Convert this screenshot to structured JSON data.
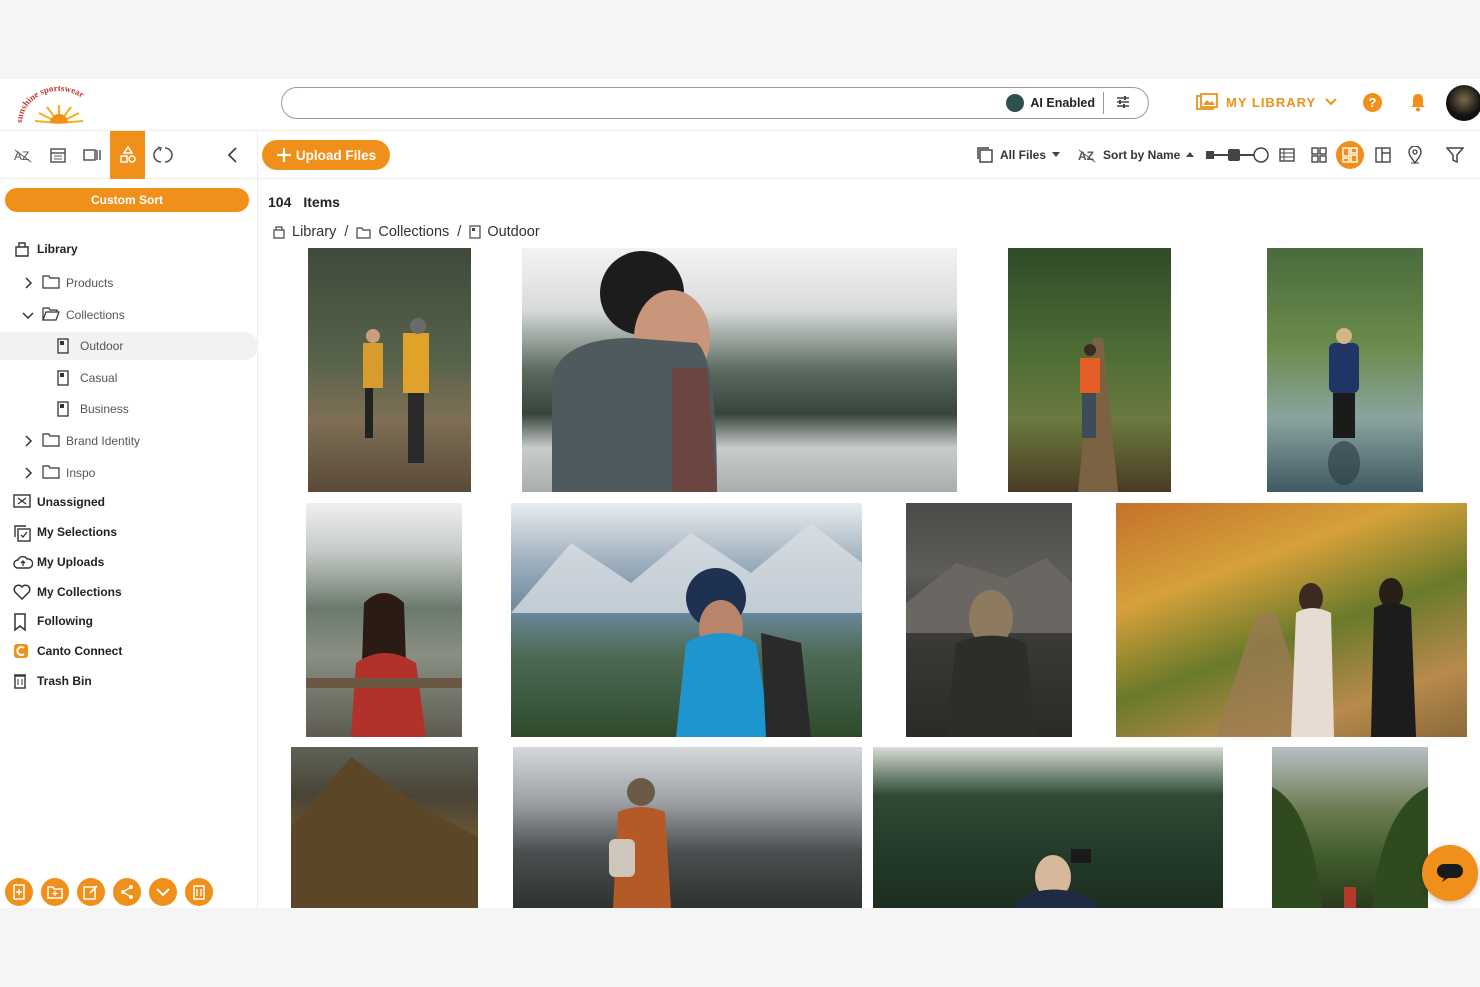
{
  "header": {
    "logo_text": "sunshine sportswear",
    "search": {
      "value": "",
      "placeholder": ""
    },
    "ai_label": "AI Enabled",
    "library_label": "MY LIBRARY",
    "help_label": "?"
  },
  "sidebar": {
    "tool_icons": [
      "sort-az-icon",
      "calendar-icon",
      "filmstrip-icon",
      "shapes-icon",
      "refresh-icon",
      "collapse-icon"
    ],
    "custom_sort_label": "Custom Sort",
    "items": [
      {
        "label": "Library",
        "style": "bold",
        "icon": "library-icon"
      },
      {
        "label": "Products",
        "style": "light",
        "icon": "folder-icon",
        "chevron": "right"
      },
      {
        "label": "Collections",
        "style": "light",
        "icon": "folder-open-icon",
        "chevron": "down"
      },
      {
        "label": "Outdoor",
        "style": "light",
        "icon": "collection-doc-icon",
        "selected": true
      },
      {
        "label": "Casual",
        "style": "light",
        "icon": "collection-doc-icon"
      },
      {
        "label": "Business",
        "style": "light",
        "icon": "collection-doc-icon"
      },
      {
        "label": "Brand Identity",
        "style": "light",
        "icon": "folder-icon",
        "chevron": "right"
      },
      {
        "label": "Inspo",
        "style": "light",
        "icon": "folder-icon",
        "chevron": "right"
      },
      {
        "label": "Unassigned",
        "style": "bold",
        "icon": "unassigned-icon"
      },
      {
        "label": "My Selections",
        "style": "bold",
        "icon": "selections-icon"
      },
      {
        "label": "My Uploads",
        "style": "bold",
        "icon": "cloud-upload-icon"
      },
      {
        "label": "My Collections",
        "style": "bold",
        "icon": "heart-icon"
      },
      {
        "label": "Following",
        "style": "bold",
        "icon": "bookmark-icon"
      },
      {
        "label": "Canto Connect",
        "style": "bold",
        "icon": "canto-connect-icon"
      },
      {
        "label": "Trash Bin",
        "style": "bold",
        "icon": "trash-icon"
      }
    ],
    "bottom_actions": [
      "add-document-icon",
      "add-folder-icon",
      "edit-icon",
      "share-icon",
      "download-icon",
      "delete-icon"
    ]
  },
  "toolbar": {
    "upload_label": "Upload Files",
    "all_files_label": "All Files",
    "sort_label": "Sort by Name",
    "view_icons": [
      "list-view-icon",
      "grid-view-icon",
      "masonry-view-icon",
      "split-view-icon",
      "map-pin-icon",
      "filter-icon"
    ],
    "active_view": "masonry-view-icon"
  },
  "content": {
    "count": "104",
    "count_label": "Items",
    "breadcrumb": [
      "Library",
      "Collections",
      "Outdoor"
    ]
  },
  "colors": {
    "accent": "#f0901a",
    "text": "#222222",
    "border": "#ececec"
  }
}
